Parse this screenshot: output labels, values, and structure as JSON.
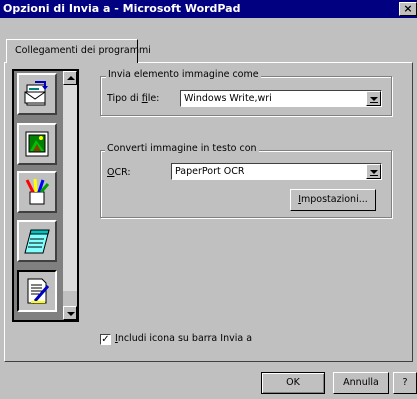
{
  "window": {
    "title": "Opzioni di Invia a - Microsoft WordPad",
    "close_glyph": "×"
  },
  "tabs": [
    {
      "label": "Collegamenti dei programmi"
    }
  ],
  "program_list": {
    "items": [
      {
        "name": "send-to-mail-icon",
        "selected": false
      },
      {
        "name": "picture-icon",
        "selected": false
      },
      {
        "name": "paint-brushes-icon",
        "selected": false
      },
      {
        "name": "notepad-icon",
        "selected": false
      },
      {
        "name": "wordpad-document-icon",
        "selected": true
      }
    ]
  },
  "image_group": {
    "legend": "Invia elemento immagine come",
    "file_type_label": "Tipo di file:",
    "file_type_value": "Windows Write,wri"
  },
  "ocr_group": {
    "legend": "Converti immagine in testo con",
    "ocr_label": "OCR:",
    "ocr_value": "PaperPort OCR",
    "settings_button": "Impostazioni..."
  },
  "include_icon": {
    "label": "Includi icona su barra Invia a",
    "checked": true,
    "check_glyph": "✓"
  },
  "footer": {
    "ok": "OK",
    "cancel": "Annulla",
    "help": "?"
  }
}
